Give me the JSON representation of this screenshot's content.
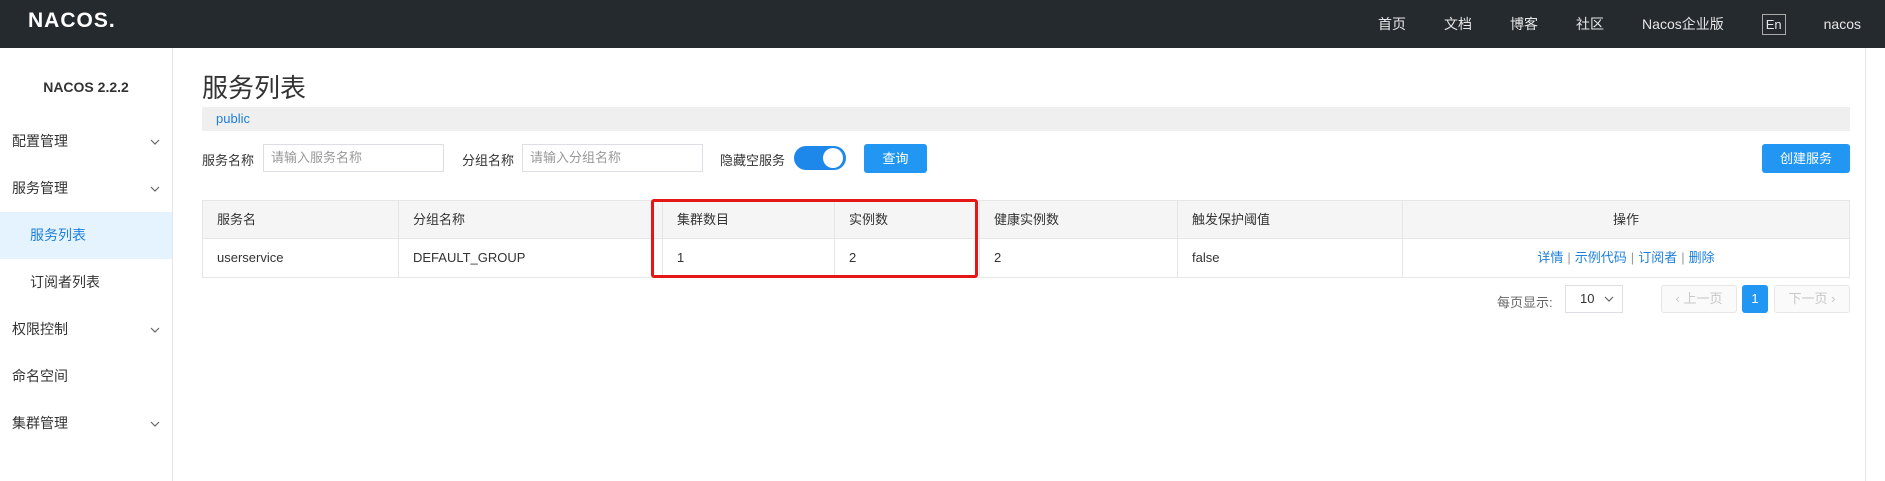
{
  "topbar": {
    "logo": "NACOS.",
    "nav": [
      "首页",
      "文档",
      "博客",
      "社区",
      "Nacos企业版"
    ],
    "lang": "En",
    "user": "nacos"
  },
  "sidebar": {
    "version": "NACOS 2.2.2",
    "items": [
      {
        "label": "配置管理",
        "expandable": true
      },
      {
        "label": "服务管理",
        "expandable": true
      },
      {
        "label": "服务列表",
        "sub": true,
        "active": true
      },
      {
        "label": "订阅者列表",
        "sub": true
      },
      {
        "label": "权限控制",
        "expandable": true
      },
      {
        "label": "命名空间"
      },
      {
        "label": "集群管理",
        "expandable": true
      }
    ]
  },
  "main": {
    "title": "服务列表",
    "namespace": "public",
    "filter": {
      "service_name_label": "服务名称",
      "service_name_placeholder": "请输入服务名称",
      "group_name_label": "分组名称",
      "group_name_placeholder": "请输入分组名称",
      "hide_empty_label": "隐藏空服务",
      "hide_empty_on": true,
      "query_button": "查询",
      "create_button": "创建服务"
    },
    "table": {
      "headers": [
        "服务名",
        "分组名称",
        "集群数目",
        "实例数",
        "健康实例数",
        "触发保护阈值",
        "操作"
      ],
      "rows": [
        {
          "service": "userservice",
          "group": "DEFAULT_GROUP",
          "clusters": "1",
          "instances": "2",
          "healthy": "2",
          "threshold": "false",
          "ops": [
            "详情",
            "示例代码",
            "订阅者",
            "删除"
          ],
          "sep": "|"
        }
      ]
    },
    "pagination": {
      "page_size_label": "每页显示:",
      "page_size": "10",
      "prev": "上一页",
      "current": "1",
      "next": "下一页"
    }
  },
  "colors": {
    "topbar": "#252a2f",
    "primary": "#2196f3",
    "link": "#1e7fdc",
    "highlight_box": "#e51616"
  }
}
